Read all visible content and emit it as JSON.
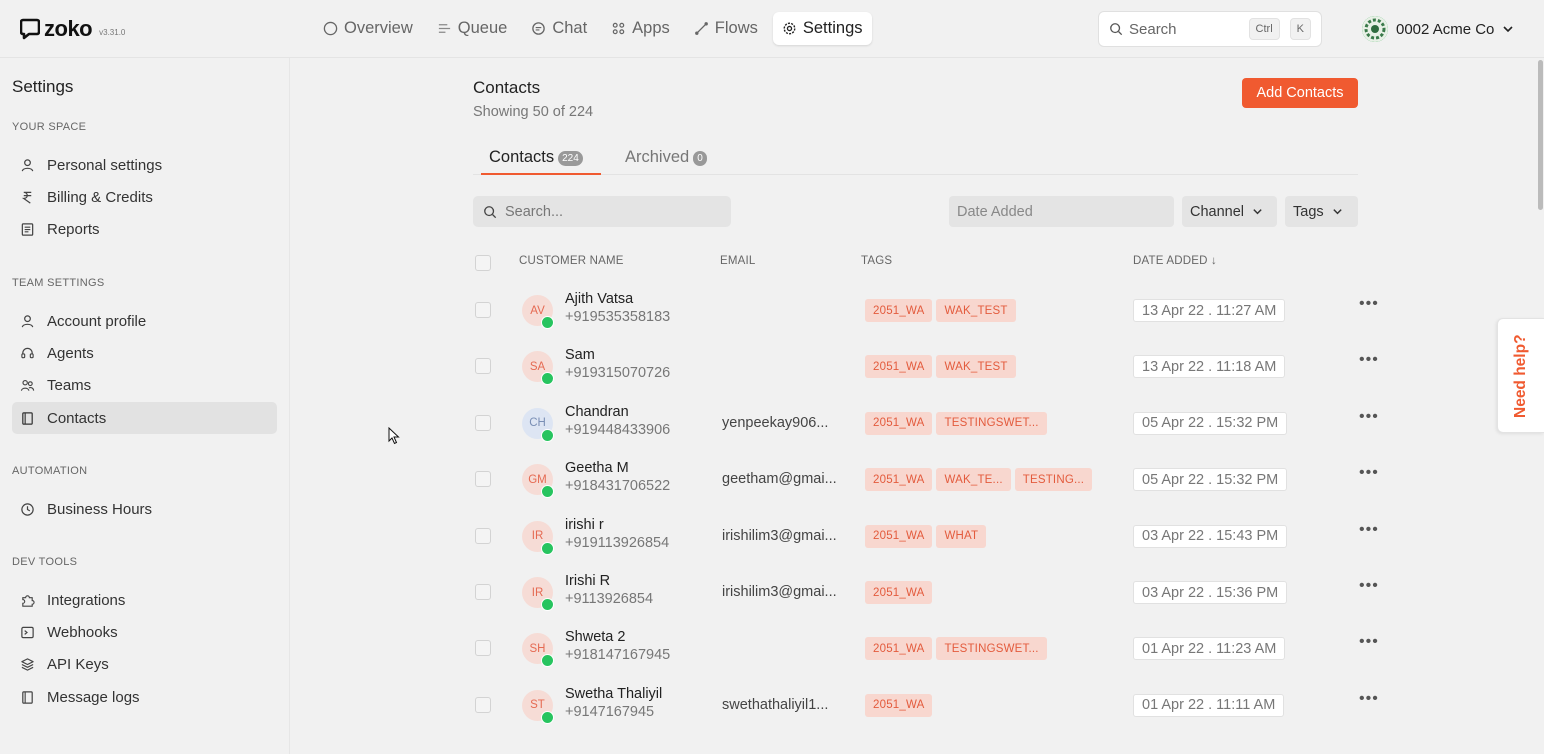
{
  "brand": {
    "name": "zoko",
    "version": "v3.31.0"
  },
  "nav": {
    "items": [
      {
        "label": "Overview",
        "icon": "circle-icon"
      },
      {
        "label": "Queue",
        "icon": "queue-icon"
      },
      {
        "label": "Chat",
        "icon": "chat-icon"
      },
      {
        "label": "Apps",
        "icon": "grid-icon"
      },
      {
        "label": "Flows",
        "icon": "flow-icon"
      },
      {
        "label": "Settings",
        "icon": "gear-icon"
      }
    ],
    "active": "Settings"
  },
  "search": {
    "placeholder": "Search",
    "kbd1": "Ctrl",
    "kbd2": "K"
  },
  "account": {
    "name": "0002 Acme Co"
  },
  "sidebar": {
    "title": "Settings",
    "sections": [
      {
        "label": "YOUR SPACE",
        "items": [
          "Personal settings",
          "Billing & Credits",
          "Reports"
        ]
      },
      {
        "label": "TEAM SETTINGS",
        "items": [
          "Account profile",
          "Agents",
          "Teams",
          "Contacts"
        ]
      },
      {
        "label": "AUTOMATION",
        "items": [
          "Business Hours"
        ]
      },
      {
        "label": "DEV TOOLS",
        "items": [
          "Integrations",
          "Webhooks",
          "API Keys",
          "Message logs"
        ]
      }
    ],
    "active": "Contacts"
  },
  "main": {
    "title": "Contacts",
    "subtitle": "Showing 50 of 224",
    "add_button": "Add Contacts",
    "tabs": [
      {
        "label": "Contacts",
        "count": "224"
      },
      {
        "label": "Archived",
        "count": "0"
      }
    ],
    "filter_search_placeholder": "Search...",
    "date_filter_placeholder": "Date Added",
    "channel_label": "Channel",
    "tags_label": "Tags",
    "columns": {
      "name": "CUSTOMER NAME",
      "email": "EMAIL",
      "tags": "TAGS",
      "date": "DATE ADDED ↓"
    },
    "rows": [
      {
        "initials": "AV",
        "name": "Ajith Vatsa",
        "phone": "+919535358183",
        "email": "",
        "tags": [
          "2051_WA",
          "WAK_TEST"
        ],
        "date": "13 Apr 22 . 11:27 AM",
        "avatar_color": "peach"
      },
      {
        "initials": "SA",
        "name": "Sam",
        "phone": "+919315070726",
        "email": "",
        "tags": [
          "2051_WA",
          "WAK_TEST"
        ],
        "date": "13 Apr 22 . 11:18 AM",
        "avatar_color": "peach"
      },
      {
        "initials": "CH",
        "name": "Chandran",
        "phone": "+919448433906",
        "email": "yenpeekay906...",
        "tags": [
          "2051_WA",
          "TESTINGSWET..."
        ],
        "date": "05 Apr 22 . 15:32 PM",
        "avatar_color": "blue"
      },
      {
        "initials": "GM",
        "name": "Geetha M",
        "phone": "+918431706522",
        "email": "geetham@gmai...",
        "tags": [
          "2051_WA",
          "WAK_TE...",
          "TESTING..."
        ],
        "date": "05 Apr 22 . 15:32 PM",
        "avatar_color": "peach"
      },
      {
        "initials": "IR",
        "name": "irishi r",
        "phone": "+919113926854",
        "email": "irishilim3@gmai...",
        "tags": [
          "2051_WA",
          "WHAT"
        ],
        "date": "03 Apr 22 . 15:43 PM",
        "avatar_color": "peach"
      },
      {
        "initials": "IR",
        "name": "Irishi R",
        "phone": "+9113926854",
        "email": "irishilim3@gmai...",
        "tags": [
          "2051_WA"
        ],
        "date": "03 Apr 22 . 15:36 PM",
        "avatar_color": "peach"
      },
      {
        "initials": "SH",
        "name": "Shweta 2",
        "phone": "+918147167945",
        "email": "",
        "tags": [
          "2051_WA",
          "TESTINGSWET..."
        ],
        "date": "01 Apr 22 . 11:23 AM",
        "avatar_color": "peach"
      },
      {
        "initials": "ST",
        "name": "Swetha Thaliyil",
        "phone": "+9147167945",
        "email": "swethathaliyil1...",
        "tags": [
          "2051_WA"
        ],
        "date": "01 Apr 22 . 11:11 AM",
        "avatar_color": "peach"
      }
    ]
  },
  "help": {
    "label": "Need help?"
  },
  "colors": {
    "accent": "#f05a30",
    "tag_bg": "#f8d7cf",
    "tag_text": "#e35b3d",
    "whatsapp": "#27c45f"
  }
}
